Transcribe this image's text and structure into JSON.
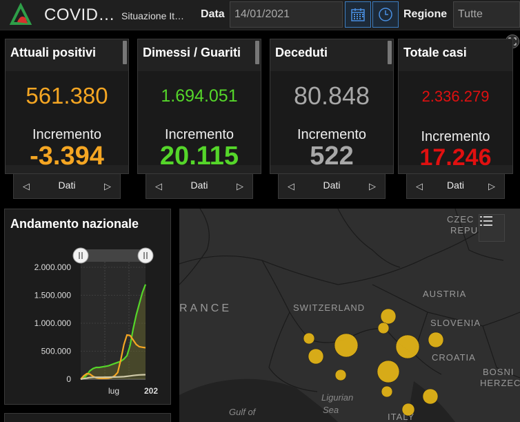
{
  "header": {
    "title": "COVID…",
    "subtitle": "Situazione It…",
    "date_label": "Data",
    "date_value": "14/01/2021",
    "region_label": "Regione",
    "region_value": "Tutte"
  },
  "cards": [
    {
      "title": "Attuali positivi",
      "value": "561.380",
      "increment_label": "Incremento",
      "increment": "-3.394",
      "nav_label": "Dati",
      "color": "#f5a623"
    },
    {
      "title": "Dimessi / Guariti",
      "value": "1.694.051",
      "increment_label": "Incremento",
      "increment": "20.115",
      "nav_label": "Dati",
      "color": "#55d62a"
    },
    {
      "title": "Deceduti",
      "value": "80.848",
      "increment_label": "Incremento",
      "increment": "522",
      "nav_label": "Dati",
      "color": "#a8a8a8"
    },
    {
      "title": "Totale casi",
      "value": "2.336.279",
      "increment_label": "Incremento",
      "increment": "17.246",
      "nav_label": "Dati",
      "color": "#e01010"
    }
  ],
  "chart_data": {
    "type": "line",
    "title": "Andamento nazionale",
    "ylim": [
      0,
      2000000
    ],
    "y_ticks": [
      "2.000.000",
      "1.500.000",
      "1.000.000",
      "500.000",
      "0"
    ],
    "x_ticks": [
      "lug",
      "202"
    ],
    "x": [
      0,
      1,
      2,
      3,
      4,
      5,
      6,
      7,
      8,
      9,
      10,
      11,
      12,
      13,
      14,
      15,
      16,
      17,
      18,
      19,
      20,
      21
    ],
    "series": [
      {
        "color": "#55d62a",
        "values": [
          0,
          20000,
          80000,
          150000,
          190000,
          210000,
          210000,
          220000,
          230000,
          240000,
          260000,
          280000,
          300000,
          320000,
          360000,
          420000,
          600000,
          900000,
          1150000,
          1350000,
          1550000,
          1694051
        ]
      },
      {
        "color": "#f5a623",
        "values": [
          0,
          60000,
          100000,
          90000,
          50000,
          25000,
          15000,
          13000,
          15000,
          20000,
          30000,
          60000,
          120000,
          350000,
          620000,
          790000,
          780000,
          700000,
          620000,
          580000,
          570000,
          561380
        ]
      },
      {
        "color": "#cfc9a8",
        "values": [
          0,
          10000,
          20000,
          30000,
          33000,
          34000,
          35000,
          35000,
          35500,
          36000,
          36500,
          38000,
          40000,
          42000,
          45000,
          50000,
          58000,
          66000,
          72000,
          76000,
          79000,
          80848
        ]
      }
    ]
  },
  "map": {
    "labels": {
      "czech": "CZEC",
      "czech2": "REPUB",
      "france": "RANCE",
      "switzerland": "SWITZERLAND",
      "austria": "AUSTRIA",
      "slovenia": "SLOVENIA",
      "croatia": "CROATIA",
      "bosnia1": "BOSNI",
      "bosnia2": "HERZEC",
      "italy": "ITALY",
      "ligurian1": "Ligurian",
      "ligurian2": "Sea",
      "gulf": "Gulf of"
    },
    "bubble_color": "#e0b217"
  }
}
